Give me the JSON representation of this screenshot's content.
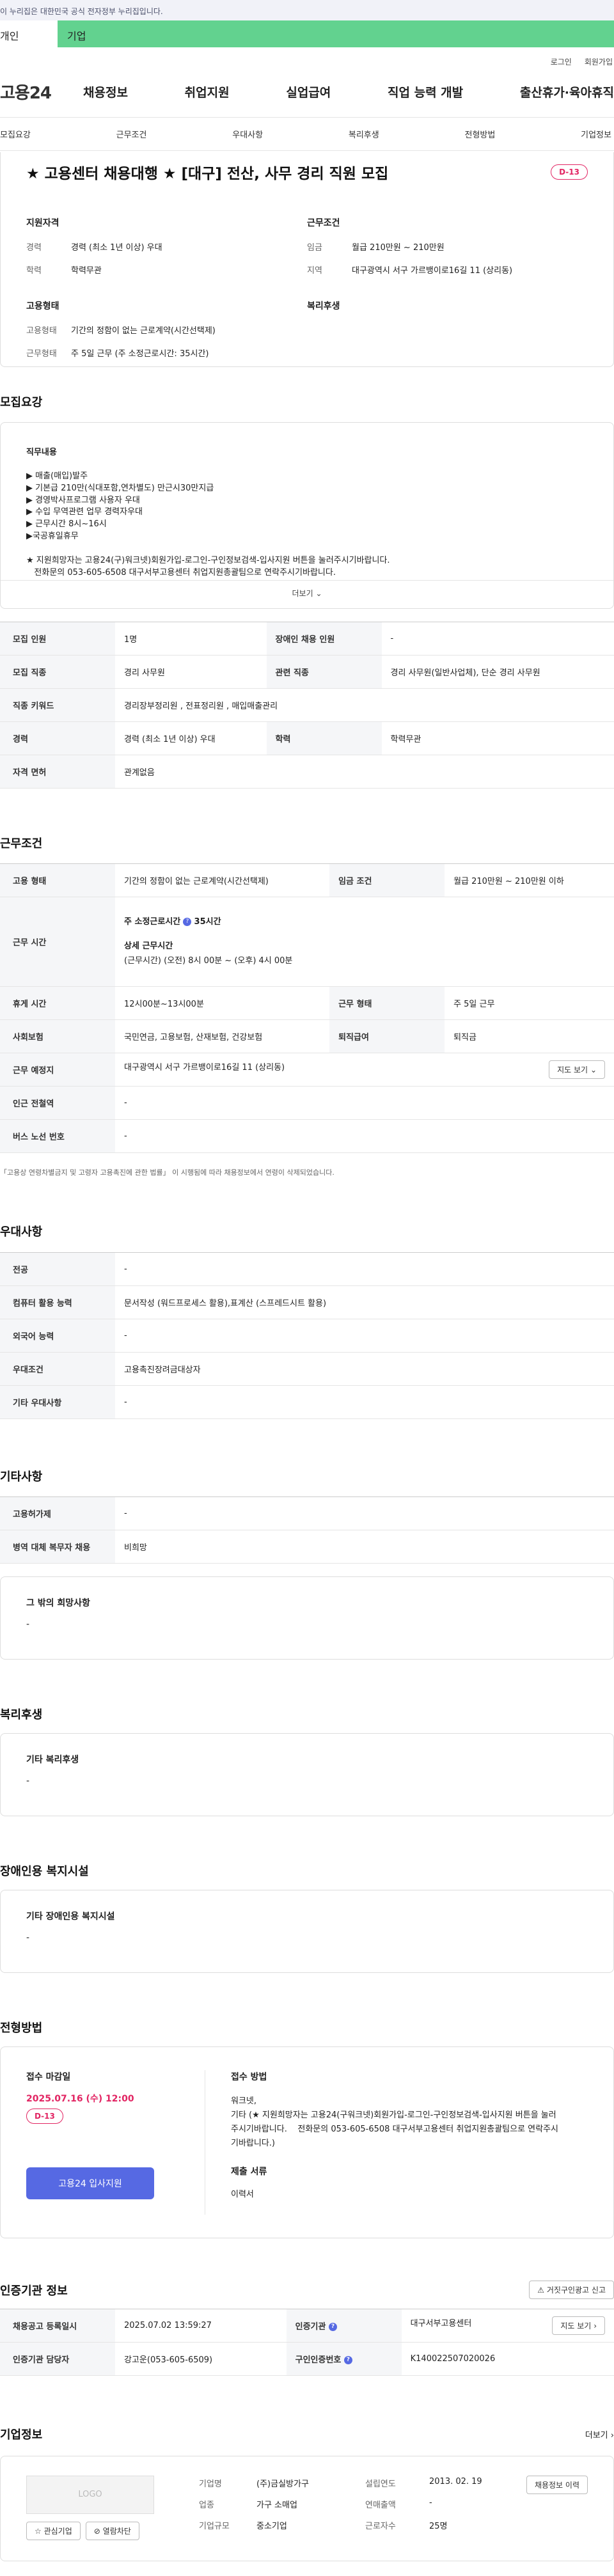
{
  "gov_banner": "이 누리집은 대한민국 공식 전자정부 누리집입니다.",
  "tabs": {
    "personal": "개인",
    "company": "기업"
  },
  "util": {
    "login": "로그인",
    "signup": "회원가입"
  },
  "logo": "고용24",
  "gnb": [
    "채용정보",
    "취업지원",
    "실업급여",
    "직업 능력 개발",
    "출산휴가·육아휴직"
  ],
  "lnb": [
    "모집요강",
    "근무조건",
    "우대사항",
    "복리후생",
    "전형방법",
    "기업정보"
  ],
  "job": {
    "title": "★ 고용센터 채용대행 ★ [대구] 전산, 사무 경리 직원 모집",
    "dday": "D-13",
    "qual_h": "지원자격",
    "cond_h": "근무조건",
    "emp_h": "고용형태",
    "welfare_h": "복리후생",
    "career_k": "경력",
    "career_v": "경력 (최소 1년 이상) 우대",
    "edu_k": "학력",
    "edu_v": "학력무관",
    "wage_k": "임금",
    "wage_v": "월급 210만원 ~ 210만원",
    "region_k": "지역",
    "region_v": "대구광역시 서구 가르뱅이로16길 11 (상리동)",
    "emptype_k": "고용형태",
    "emptype_v": "기간의 정함이 없는 근로계약(시간선택제)",
    "worktype_k": "근무형태",
    "worktype_v": "주 5일 근무 (주 소정근로시간: 35시간)"
  },
  "recruit": {
    "h": "모집요강",
    "duty_h": "직무내용",
    "lines": [
      "▶ 매출(매입)발주",
      "▶ 기본급 210만(식대포함,연차별도) 만근시30만지급",
      "▶ 경영박사프로그램 사용자 우대",
      "▶ 수입 무역관련 업무 경력자우대",
      "▶ 근무시간 8시~16시",
      "▶국공휴일휴무",
      "",
      "★ 지원희망자는 고용24(구)워크넷)회원가입-로그인-구인정보검색-입사지원 버튼을 눌러주시기바랍니다.",
      "   전화문의 053-605-6508 대구서부고용센터 취업지원총괄팀으로 연락주시기바랍니다."
    ],
    "more": "더보기",
    "rows": [
      [
        "모집 인원",
        "1명",
        "장애인 채용 인원",
        "-"
      ],
      [
        "모집 직종",
        "경리 사무원",
        "관련 직종",
        "경리 사무원(일반사업체), 단순 경리 사무원"
      ],
      [
        "직종 키워드",
        "경리장부정리원 , 전표정리원 , 매입매출관리",
        "",
        ""
      ],
      [
        "경력",
        "경력 (최소 1년 이상) 우대",
        "학력",
        "학력무관"
      ],
      [
        "자격 면허",
        "관계없음",
        "",
        ""
      ]
    ]
  },
  "work": {
    "h": "근무조건",
    "emp_k": "고용 형태",
    "emp_v": "기간의 정함이 없는 근로계약(시간선택제)",
    "wage_k": "임금 조건",
    "wage_v": "월급 210만원 ~ 210만원 이하",
    "time_k": "근무 시간",
    "time_a": "주 소정근로시간",
    "time_b": "35시간",
    "time_c": "상세 근무시간",
    "time_d": "(근무시간) (오전) 8시 00분 ~ (오후) 4시 00분",
    "break_k": "휴게 시간",
    "break_v": "12시00분~13시00분",
    "form_k": "근무 형태",
    "form_v": "주 5일 근무",
    "ins_k": "사회보험",
    "ins_v": "국민연금, 고용보험, 산재보험, 건강보험",
    "ret_k": "퇴직급여",
    "ret_v": "퇴직금",
    "loc_k": "근무 예정지",
    "loc_v": "대구광역시 서구 가르뱅이로16길 11 (상리동)",
    "map_btn": "지도 보기",
    "sub_k": "인근 전철역",
    "sub_v": "-",
    "bus_k": "버스 노선 번호",
    "bus_v": "-",
    "note": "「고용상 연령차별금지 및 고령자 고용촉진에 관한 법률」 이 시행됨에 따라 채용정보에서 연령이 삭제되었습니다."
  },
  "pref": {
    "h": "우대사항",
    "rows": [
      [
        "전공",
        "-"
      ],
      [
        "컴퓨터 활용 능력",
        "문서작성 (워드프로세스 활용),표계산 (스프레드시트 활용)"
      ],
      [
        "외국어 능력",
        "-"
      ],
      [
        "우대조건",
        "고용촉진장려금대상자"
      ],
      [
        "기타 우대사항",
        "-"
      ]
    ]
  },
  "etc": {
    "h": "기타사항",
    "rows": [
      [
        "고용허가제",
        "-"
      ],
      [
        "병역 대체 복무자 채용",
        "비희망"
      ]
    ],
    "hope_h": "그 밖의 희망사항",
    "hope_v": "-"
  },
  "welfare": {
    "h": "복리후생",
    "sub": "기타 복리후생",
    "v": "-"
  },
  "disabled": {
    "h": "장애인용 복지시설",
    "sub": "기타 장애인용 복지시설",
    "v": "-"
  },
  "screen": {
    "h": "전형방법",
    "deadline_h": "접수 마감일",
    "deadline": "2025.07.16 (수) 12:00",
    "dday": "D-13",
    "apply_btn": "고용24 입사지원",
    "method_h": "접수 방법",
    "method": [
      "워크넷,",
      "기타 (★ 지원희망자는 고용24(구워크넷)회원가입-로그인-구인정보검색-입사지원 버튼을 눌러",
      "주시기바랍니다.    전화문의 053-605-6508 대구서부고용센터 취업지원총괄팀으로 연락주시",
      "기바랍니다.)"
    ],
    "docs_h": "제출 서류",
    "docs": "이력서"
  },
  "agency": {
    "h": "인증기관 정보",
    "report_btn": "거짓구인광고 신고",
    "date_k": "채용공고 등록일시",
    "date_v": "2025.07.02 13:59:27",
    "org_k": "인증기관",
    "org_v": "대구서부고용센터",
    "map_btn": "지도 보기",
    "mgr_k": "인증기관 담당자",
    "mgr_v": "강고운(053-605-6509)",
    "no_k": "구인인증번호",
    "no_v": "K140022507020026"
  },
  "company": {
    "h": "기업정보",
    "more": "더보기",
    "logo": "LOGO",
    "fav_btn": "관심기업",
    "like_btn": "열람차단",
    "name_k": "기업명",
    "name_v": "(주)금실방가구",
    "found_k": "설립연도",
    "found_v": "2013. 02. 19",
    "ind_k": "업종",
    "ind_v": "가구 소매업",
    "sales_k": "연매출액",
    "sales_v": "-",
    "size_k": "기업규모",
    "size_v": "중소기업",
    "emp_k": "근로자수",
    "emp_v": "25명",
    "jobs_btn": "채용정보 이력"
  },
  "colors": {
    "accent": "#5669e3",
    "dday": "#e22563",
    "green": "#62d28f"
  }
}
